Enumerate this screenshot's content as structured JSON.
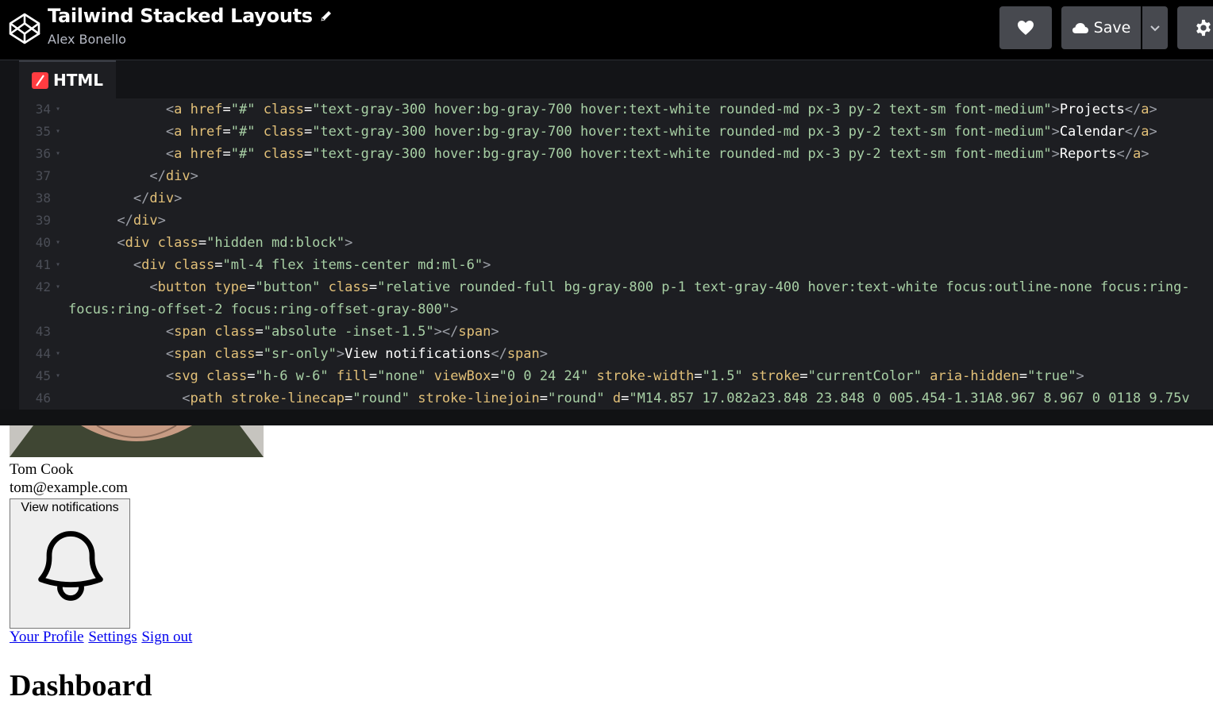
{
  "header": {
    "title": "Tailwind Stacked Layouts",
    "author": "Alex Bonello",
    "save_label": "Save"
  },
  "editor": {
    "tab_label": "HTML",
    "lines": [
      {
        "n": "34",
        "fold": "▾",
        "text": "            <a href=\"#\" class=\"text-gray-300 hover:bg-gray-700 hover:text-white rounded-md px-3 py-2 text-sm font-medium\">Projects</a>"
      },
      {
        "n": "35",
        "fold": "▾",
        "text": "            <a href=\"#\" class=\"text-gray-300 hover:bg-gray-700 hover:text-white rounded-md px-3 py-2 text-sm font-medium\">Calendar</a>"
      },
      {
        "n": "36",
        "fold": "▾",
        "text": "            <a href=\"#\" class=\"text-gray-300 hover:bg-gray-700 hover:text-white rounded-md px-3 py-2 text-sm font-medium\">Reports</a>"
      },
      {
        "n": "37",
        "fold": "",
        "text": "          </div>"
      },
      {
        "n": "38",
        "fold": "",
        "text": "        </div>"
      },
      {
        "n": "39",
        "fold": "",
        "text": "      </div>"
      },
      {
        "n": "40",
        "fold": "▾",
        "text": "      <div class=\"hidden md:block\">"
      },
      {
        "n": "41",
        "fold": "▾",
        "text": "        <div class=\"ml-4 flex items-center md:ml-6\">"
      },
      {
        "n": "42",
        "fold": "▾",
        "text": "          <button type=\"button\" class=\"relative rounded-full bg-gray-800 p-1 text-gray-400 hover:text-white focus:outline-none focus:ring-"
      },
      {
        "n": "",
        "fold": "",
        "text": "focus:ring-offset-2 focus:ring-offset-gray-800\">"
      },
      {
        "n": "43",
        "fold": "",
        "text": "            <span class=\"absolute -inset-1.5\"></span>"
      },
      {
        "n": "44",
        "fold": "▾",
        "text": "            <span class=\"sr-only\">View notifications</span>"
      },
      {
        "n": "45",
        "fold": "▾",
        "text": "            <svg class=\"h-6 w-6\" fill=\"none\" viewBox=\"0 0 24 24\" stroke-width=\"1.5\" stroke=\"currentColor\" aria-hidden=\"true\">"
      },
      {
        "n": "46",
        "fold": "",
        "text": "              <path stroke-linecap=\"round\" stroke-linejoin=\"round\" d=\"M14.857 17.082a23.848 23.848 0 005.454-1.31A8.967 8.967 0 0118 9.75v"
      }
    ]
  },
  "preview": {
    "name": "Tom Cook",
    "email": "tom@example.com",
    "notif_label": "View notifications",
    "links": [
      "Your Profile",
      "Settings",
      "Sign out"
    ],
    "heading": "Dashboard"
  }
}
